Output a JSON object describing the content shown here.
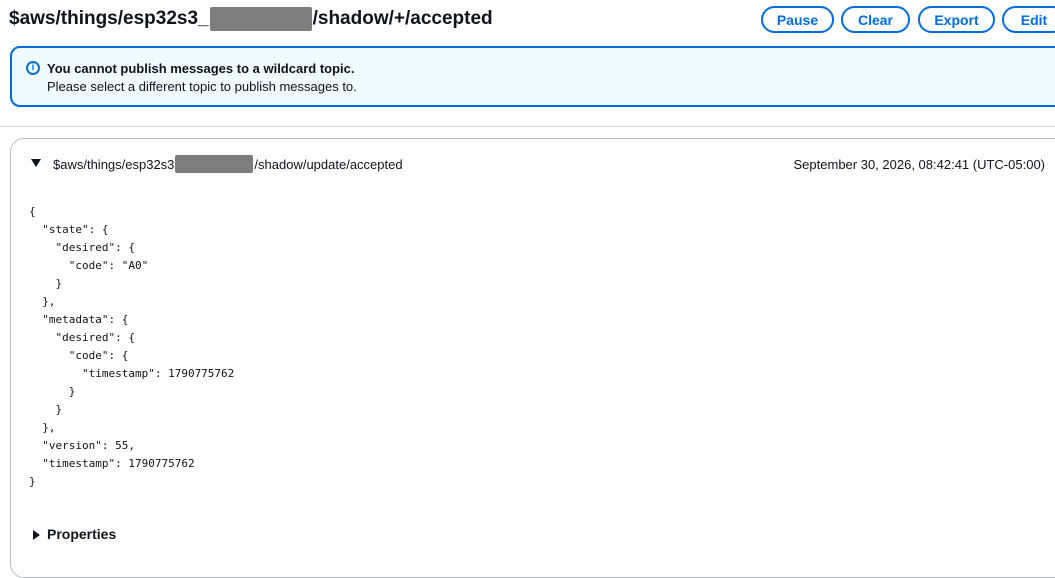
{
  "header": {
    "title_prefix": "$aws/things/esp32s3_",
    "title_suffix": "/shadow/+/accepted",
    "buttons": {
      "pause": "Pause",
      "clear": "Clear",
      "export": "Export",
      "edit": "Edit"
    }
  },
  "alert": {
    "icon": "info-icon",
    "title": "You cannot publish messages to a wildcard topic.",
    "body": "Please select a different topic to publish messages to."
  },
  "message": {
    "topic_prefix": "$aws/things/esp32s3",
    "topic_suffix": "/shadow/update/accepted",
    "timestamp": "September 30, 2026, 08:42:41 (UTC-05:00)",
    "payload": "{\n  \"state\": {\n    \"desired\": {\n      \"code\": \"A0\"\n    }\n  },\n  \"metadata\": {\n    \"desired\": {\n      \"code\": {\n        \"timestamp\": 1790775762\n      }\n    }\n  },\n  \"version\": 55,\n  \"timestamp\": 1790775762\n}",
    "properties_label": "Properties"
  },
  "colors": {
    "accent": "#006ce0",
    "alert_bg": "#f0fbff",
    "redaction": "#7d7d7d"
  }
}
